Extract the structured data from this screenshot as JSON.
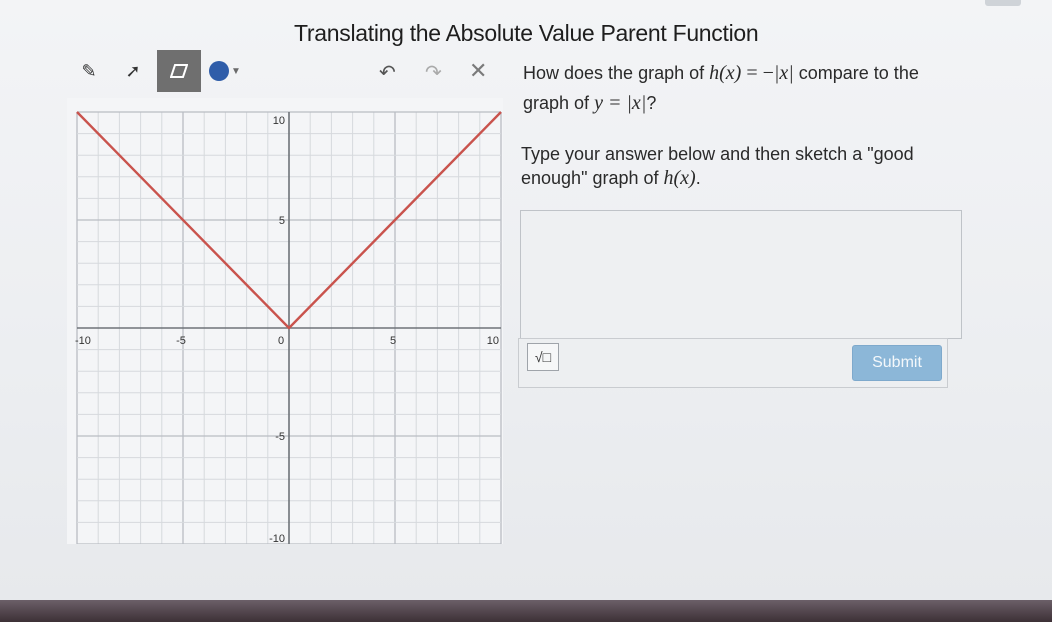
{
  "title": "Translating the Absolute Value Parent Function",
  "toolbar": {
    "tools": [
      "pencil-icon",
      "line-icon",
      "eraser-icon"
    ],
    "active_tool": "eraser-icon",
    "color": "#2f5da9",
    "undo_icon": "undo-icon",
    "redo_icon": "redo-icon",
    "clear_icon": "close-icon"
  },
  "graph": {
    "x_range": [
      -10,
      10
    ],
    "y_range": [
      -10,
      10
    ],
    "grid_step": 1,
    "x_tick_labels": [
      "-10",
      "-5",
      "0",
      "5",
      "10"
    ],
    "y_tick_labels": [
      "10",
      "5",
      "-5",
      "-10"
    ],
    "curve_color": "#c9534d",
    "curve_points": [
      [
        -10,
        10
      ],
      [
        0,
        0
      ],
      [
        10,
        10
      ]
    ]
  },
  "question": {
    "line1_prefix": "How does the graph of ",
    "h_of_x": "h(x)",
    "equals": " = −",
    "abs_x": "|x|",
    "line1_suffix": " compare to the",
    "line2_prefix": "graph of ",
    "y_eq": "y = ",
    "line2_abs": "|x|",
    "line2_suffix": "?"
  },
  "instruction": {
    "text": "Type your answer below and then sketch a \"good enough\" graph of ",
    "h_of_x": "h(x)",
    "end": "."
  },
  "answer": {
    "value": "",
    "sqrt_label": "√□",
    "submit_label": "Submit"
  }
}
